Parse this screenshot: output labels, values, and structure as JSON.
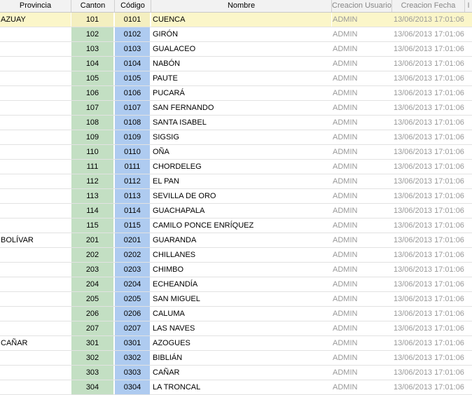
{
  "headers": {
    "provincia": "Provincia",
    "canton": "Canton",
    "codigo": "Código",
    "nombre": "Nombre",
    "creacion_usuario": "Creacion Usuario",
    "creacion_fecha": "Creacion Fecha",
    "extra": "I"
  },
  "rows": [
    {
      "provincia": "AZUAY",
      "canton": "101",
      "codigo": "0101",
      "nombre": "CUENCA",
      "usuario": "ADMIN",
      "fecha": "13/06/2013 17:01:06",
      "selected": true
    },
    {
      "provincia": "",
      "canton": "102",
      "codigo": "0102",
      "nombre": "GIRÓN",
      "usuario": "ADMIN",
      "fecha": "13/06/2013 17:01:06"
    },
    {
      "provincia": "",
      "canton": "103",
      "codigo": "0103",
      "nombre": "GUALACEO",
      "usuario": "ADMIN",
      "fecha": "13/06/2013 17:01:06"
    },
    {
      "provincia": "",
      "canton": "104",
      "codigo": "0104",
      "nombre": "NABÓN",
      "usuario": "ADMIN",
      "fecha": "13/06/2013 17:01:06"
    },
    {
      "provincia": "",
      "canton": "105",
      "codigo": "0105",
      "nombre": "PAUTE",
      "usuario": "ADMIN",
      "fecha": "13/06/2013 17:01:06"
    },
    {
      "provincia": "",
      "canton": "106",
      "codigo": "0106",
      "nombre": "PUCARÁ",
      "usuario": "ADMIN",
      "fecha": "13/06/2013 17:01:06"
    },
    {
      "provincia": "",
      "canton": "107",
      "codigo": "0107",
      "nombre": "SAN FERNANDO",
      "usuario": "ADMIN",
      "fecha": "13/06/2013 17:01:06"
    },
    {
      "provincia": "",
      "canton": "108",
      "codigo": "0108",
      "nombre": "SANTA ISABEL",
      "usuario": "ADMIN",
      "fecha": "13/06/2013 17:01:06"
    },
    {
      "provincia": "",
      "canton": "109",
      "codigo": "0109",
      "nombre": "SIGSIG",
      "usuario": "ADMIN",
      "fecha": "13/06/2013 17:01:06"
    },
    {
      "provincia": "",
      "canton": "110",
      "codigo": "0110",
      "nombre": "OÑA",
      "usuario": "ADMIN",
      "fecha": "13/06/2013 17:01:06"
    },
    {
      "provincia": "",
      "canton": "111",
      "codigo": "0111",
      "nombre": "CHORDELEG",
      "usuario": "ADMIN",
      "fecha": "13/06/2013 17:01:06"
    },
    {
      "provincia": "",
      "canton": "112",
      "codigo": "0112",
      "nombre": "EL PAN",
      "usuario": "ADMIN",
      "fecha": "13/06/2013 17:01:06"
    },
    {
      "provincia": "",
      "canton": "113",
      "codigo": "0113",
      "nombre": "SEVILLA DE ORO",
      "usuario": "ADMIN",
      "fecha": "13/06/2013 17:01:06"
    },
    {
      "provincia": "",
      "canton": "114",
      "codigo": "0114",
      "nombre": "GUACHAPALA",
      "usuario": "ADMIN",
      "fecha": "13/06/2013 17:01:06"
    },
    {
      "provincia": "",
      "canton": "115",
      "codigo": "0115",
      "nombre": "CAMILO PONCE ENRÍQUEZ",
      "usuario": "ADMIN",
      "fecha": "13/06/2013 17:01:06"
    },
    {
      "provincia": "BOLÍVAR",
      "canton": "201",
      "codigo": "0201",
      "nombre": "GUARANDA",
      "usuario": "ADMIN",
      "fecha": "13/06/2013 17:01:06"
    },
    {
      "provincia": "",
      "canton": "202",
      "codigo": "0202",
      "nombre": "CHILLANES",
      "usuario": "ADMIN",
      "fecha": "13/06/2013 17:01:06"
    },
    {
      "provincia": "",
      "canton": "203",
      "codigo": "0203",
      "nombre": "CHIMBO",
      "usuario": "ADMIN",
      "fecha": "13/06/2013 17:01:06"
    },
    {
      "provincia": "",
      "canton": "204",
      "codigo": "0204",
      "nombre": "ECHEANDÍA",
      "usuario": "ADMIN",
      "fecha": "13/06/2013 17:01:06"
    },
    {
      "provincia": "",
      "canton": "205",
      "codigo": "0205",
      "nombre": "SAN MIGUEL",
      "usuario": "ADMIN",
      "fecha": "13/06/2013 17:01:06"
    },
    {
      "provincia": "",
      "canton": "206",
      "codigo": "0206",
      "nombre": "CALUMA",
      "usuario": "ADMIN",
      "fecha": "13/06/2013 17:01:06"
    },
    {
      "provincia": "",
      "canton": "207",
      "codigo": "0207",
      "nombre": "LAS NAVES",
      "usuario": "ADMIN",
      "fecha": "13/06/2013 17:01:06"
    },
    {
      "provincia": "CAÑAR",
      "canton": "301",
      "codigo": "0301",
      "nombre": "AZOGUES",
      "usuario": "ADMIN",
      "fecha": "13/06/2013 17:01:06"
    },
    {
      "provincia": "",
      "canton": "302",
      "codigo": "0302",
      "nombre": "BIBLIÁN",
      "usuario": "ADMIN",
      "fecha": "13/06/2013 17:01:06"
    },
    {
      "provincia": "",
      "canton": "303",
      "codigo": "0303",
      "nombre": "CAÑAR",
      "usuario": "ADMIN",
      "fecha": "13/06/2013 17:01:06"
    },
    {
      "provincia": "",
      "canton": "304",
      "codigo": "0304",
      "nombre": "LA TRONCAL",
      "usuario": "ADMIN",
      "fecha": "13/06/2013 17:01:06"
    }
  ]
}
